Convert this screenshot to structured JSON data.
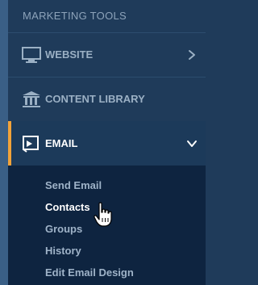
{
  "sidebar": {
    "section_title": "MARKETING TOOLS",
    "items": [
      {
        "label": "WEBSITE",
        "icon": "monitor-icon",
        "chevron": "chevron-right-icon"
      },
      {
        "label": "CONTENT LIBRARY",
        "icon": "library-icon"
      },
      {
        "label": "EMAIL",
        "icon": "email-icon",
        "chevron": "chevron-down-icon",
        "expanded": true
      }
    ],
    "email_submenu": [
      {
        "label": "Send Email"
      },
      {
        "label": "Contacts",
        "active": true
      },
      {
        "label": "Groups"
      },
      {
        "label": "History"
      },
      {
        "label": "Edit Email Design"
      }
    ]
  },
  "colors": {
    "background": "#1f3b5a",
    "left_strip": "#3a5f86",
    "accent": "#f2a33a",
    "submenu_background": "#0e2440"
  }
}
